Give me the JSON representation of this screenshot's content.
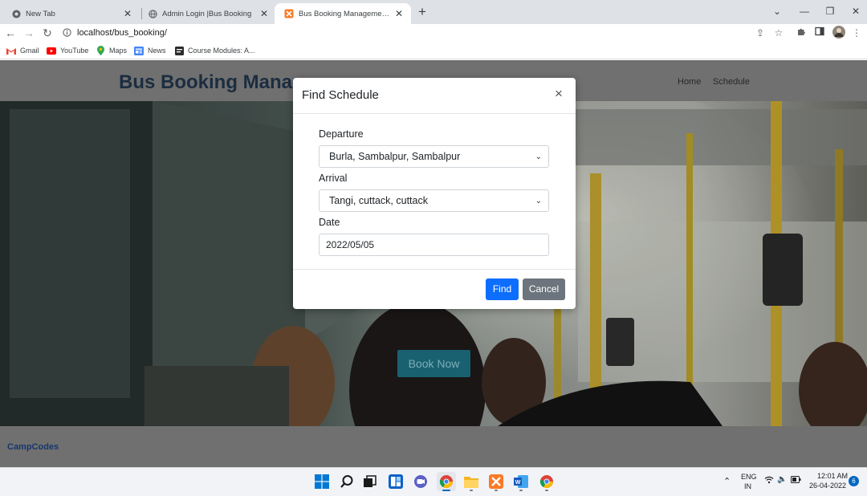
{
  "browser": {
    "tabs": [
      {
        "title": "New Tab",
        "icon": "chrome-icon",
        "active": false
      },
      {
        "title": "Admin Login |Bus Booking",
        "icon": "globe-icon",
        "active": false
      },
      {
        "title": "Bus Booking Management System",
        "icon": "xampp-icon",
        "active": true
      }
    ],
    "url": "localhost/bus_booking/",
    "bookmarks": [
      {
        "label": "Gmail",
        "icon": "gmail-icon"
      },
      {
        "label": "YouTube",
        "icon": "youtube-icon"
      },
      {
        "label": "Maps",
        "icon": "maps-icon"
      },
      {
        "label": "News",
        "icon": "news-icon"
      },
      {
        "label": "Course Modules: A...",
        "icon": "course-icon"
      }
    ]
  },
  "site": {
    "brand": "Bus Booking Mana",
    "nav": [
      "Home",
      "Schedule"
    ],
    "book_now": "Book Now",
    "footer": "CampCodes"
  },
  "modal": {
    "title": "Find Schedule",
    "close": "×",
    "departure_label": "Departure",
    "departure_value": "Burla, Sambalpur, Sambalpur",
    "arrival_label": "Arrival",
    "arrival_value": "Tangi, cuttack, cuttack",
    "date_label": "Date",
    "date_value": "2022/05/05",
    "find": "Find",
    "cancel": "Cancel"
  },
  "taskbar": {
    "lang_top": "ENG",
    "lang_bottom": "IN",
    "time": "12:01 AM",
    "date": "26-04-2022",
    "notifications": "6"
  },
  "colors": {
    "brand": "#1f3449",
    "primary": "#0d6efd",
    "secondary": "#6c757d",
    "book_now": "#1d6f80"
  }
}
